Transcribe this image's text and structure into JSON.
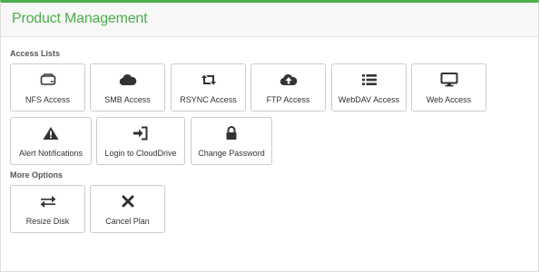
{
  "panel": {
    "title": "Product Management"
  },
  "sections": {
    "access_lists": "Access Lists",
    "more_options": "More Options"
  },
  "buttons": {
    "nfs": {
      "label": "NFS Access",
      "icon": "hdd-icon"
    },
    "smb": {
      "label": "SMB Access",
      "icon": "cloud-icon"
    },
    "rsync": {
      "label": "RSYNC Access",
      "icon": "retweet-icon"
    },
    "ftp": {
      "label": "FTP Access",
      "icon": "cloud-upload-icon"
    },
    "webdav": {
      "label": "WebDAV Access",
      "icon": "list-icon"
    },
    "web": {
      "label": "Web Access",
      "icon": "monitor-icon"
    },
    "alerts": {
      "label": "Alert Notifications",
      "icon": "warning-icon"
    },
    "clouddrive": {
      "label": "Login to CloudDrive",
      "icon": "sign-in-icon"
    },
    "password": {
      "label": "Change Password",
      "icon": "lock-icon"
    },
    "resize": {
      "label": "Resize Disk",
      "icon": "exchange-icon"
    },
    "cancel": {
      "label": "Cancel Plan",
      "icon": "close-icon"
    }
  },
  "colors": {
    "accent": "#4cae4c",
    "icon": "#333333",
    "border": "#cccccc"
  }
}
